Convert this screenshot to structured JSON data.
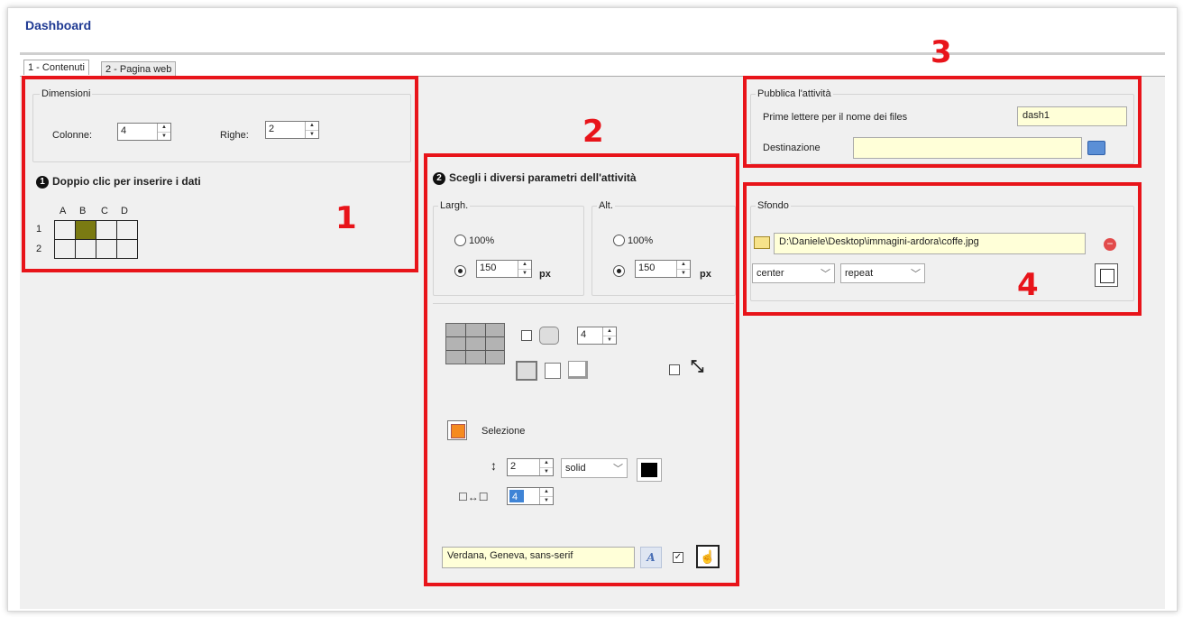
{
  "window": {
    "title": "Dashboard"
  },
  "tabs": [
    {
      "label": "1 - Contenuti"
    },
    {
      "label": "2 - Pagina web"
    }
  ],
  "dimensions": {
    "group_label": "Dimensioni",
    "columns_label": "Colonne:",
    "columns_value": "4",
    "rows_label": "Righe:",
    "rows_value": "2"
  },
  "data_grid": {
    "heading_num": "1",
    "heading": "Doppio clic per inserire i dati",
    "col_headers": [
      "A",
      "B",
      "C",
      "D"
    ],
    "row_headers": [
      "1",
      "2"
    ],
    "selected_color": "#7a7a12"
  },
  "params": {
    "heading_num": "2",
    "heading": "Scegli i diversi parametri dell'attività",
    "width_label": "Largh.",
    "height_label": "Alt.",
    "pct_option": "100%",
    "width_value": "150",
    "height_value": "150",
    "unit": "px",
    "radius_value": "4",
    "selection_label": "Selezione",
    "selection_color": "#f58a1f",
    "border_width": "2",
    "border_style": "solid",
    "border_color": "#000000",
    "spacing_value": "4",
    "font_value": "Verdana, Geneva, sans-serif"
  },
  "publish": {
    "group_label": "Pubblica l'attività",
    "prefix_label": "Prime lettere per il nome dei files",
    "prefix_value": "dash1",
    "dest_label": "Destinazione",
    "dest_value": ""
  },
  "background": {
    "group_label": "Sfondo",
    "path_value": "D:\\Daniele\\Desktop\\immagini-ardora\\coffe.jpg",
    "position_value": "center",
    "repeat_value": "repeat"
  },
  "annotations": [
    "1",
    "2",
    "3",
    "4"
  ],
  "colors": {
    "annotation_red": "#e8141a",
    "title_blue": "#1f3a93"
  }
}
